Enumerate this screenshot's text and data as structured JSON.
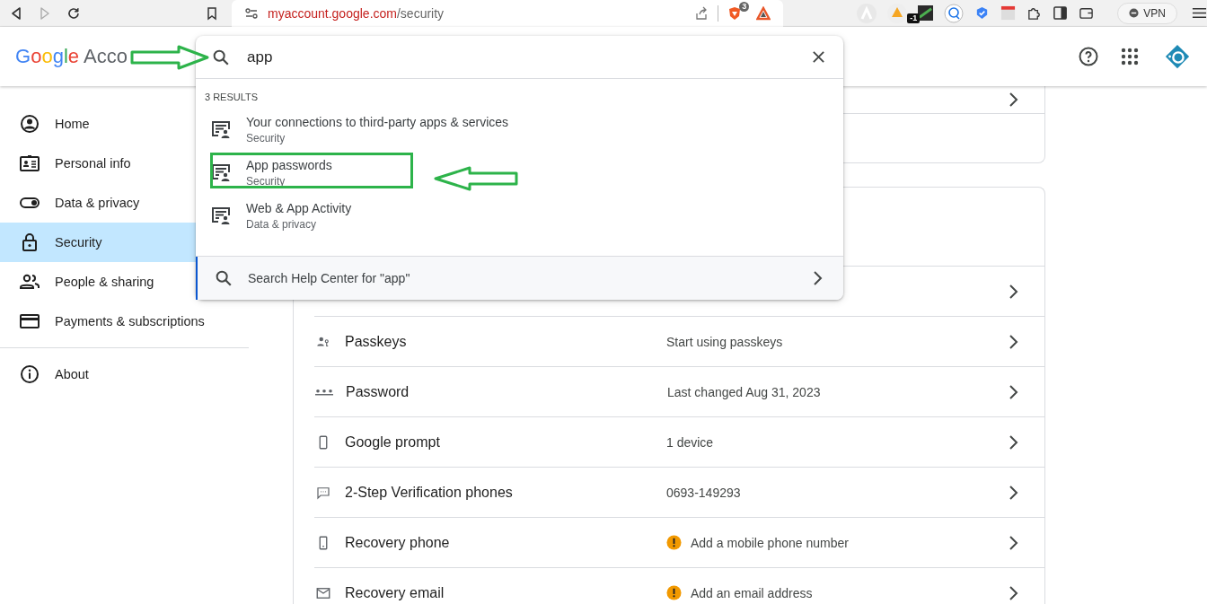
{
  "browser": {
    "url_host": "myaccount.google.com",
    "url_path": "/security",
    "shield_badge": "3",
    "extension_badge": "-1",
    "vpn_label": "VPN"
  },
  "header": {
    "logo_brand": "Google",
    "logo_product": "Acco"
  },
  "search": {
    "value": "app",
    "results_count": "3 RESULTS",
    "results": [
      {
        "title": "Your connections to third-party apps & services",
        "section": "Security",
        "highlighted": false
      },
      {
        "title": "App passwords",
        "section": "Security",
        "highlighted": true
      },
      {
        "title": "Web & App Activity",
        "section": "Data & privacy",
        "highlighted": false
      }
    ],
    "help_link": "Search Help Center for \"app\""
  },
  "sidebar": {
    "items": [
      {
        "label": "Home",
        "kind": "home",
        "selected": false
      },
      {
        "label": "Personal info",
        "kind": "id-card",
        "selected": false
      },
      {
        "label": "Data & privacy",
        "kind": "toggle",
        "selected": false
      },
      {
        "label": "Security",
        "kind": "lock",
        "selected": true
      },
      {
        "label": "People & sharing",
        "kind": "people",
        "selected": false
      },
      {
        "label": "Payments & subscriptions",
        "kind": "card",
        "selected": false
      }
    ],
    "footer_items": [
      {
        "label": "About",
        "kind": "info",
        "selected": false
      }
    ]
  },
  "security_rows": [
    {
      "label": "Passkeys",
      "kind": "passkey",
      "value": "Start using passkeys",
      "warning": false
    },
    {
      "label": "Password",
      "kind": "password",
      "value": "Last changed Aug 31, 2023",
      "warning": false
    },
    {
      "label": "Google prompt",
      "kind": "phone",
      "value": "1 device",
      "warning": false
    },
    {
      "label": "2-Step Verification phones",
      "kind": "sms",
      "value": "0693-149293",
      "warning": false
    },
    {
      "label": "Recovery phone",
      "kind": "recovery-phone",
      "value": "Add a mobile phone number",
      "warning": true
    },
    {
      "label": "Recovery email",
      "kind": "email",
      "value": "Add an email address",
      "warning": true
    }
  ]
}
